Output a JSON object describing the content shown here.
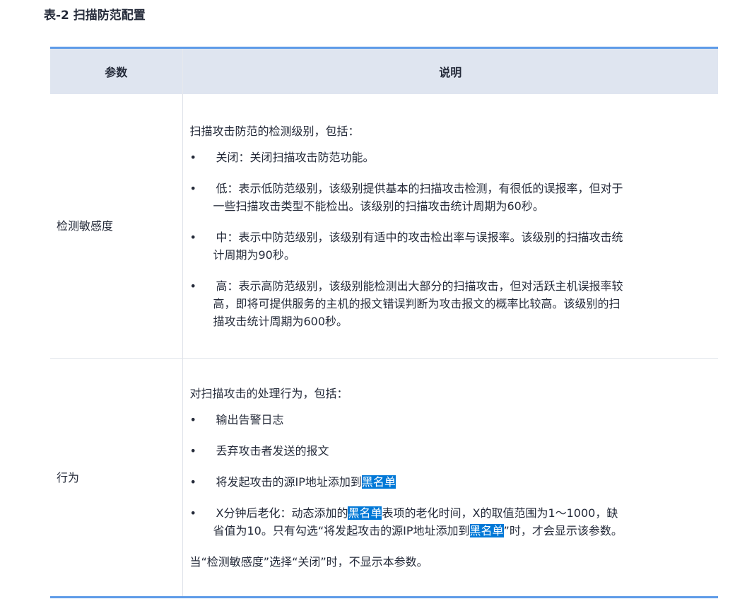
{
  "caption": "表-2 扫描防范配置",
  "table": {
    "headers": {
      "param": "参数",
      "desc": "说明"
    },
    "rows": [
      {
        "param": "检测敏感度",
        "intro": "扫描攻击防范的检测级别，包括：",
        "items": [
          "关闭：关闭扫描攻击防范功能。",
          "低：表示低防范级别，该级别提供基本的扫描攻击检测，有很低的误报率，但对于一些扫描攻击类型不能检出。该级别的扫描攻击统计周期为60秒。",
          "中：表示中防范级别，该级别有适中的攻击检出率与误报率。该级别的扫描攻击统计周期为90秒。",
          "高：表示高防范级别，该级别能检测出大部分的扫描攻击，但对活跃主机误报率较高，即将可提供服务的主机的报文错误判断为攻击报文的概率比较高。该级别的扫描攻击统计周期为600秒。"
        ]
      },
      {
        "param": "行为",
        "intro": "对扫描攻击的处理行为，包括：",
        "items": [
          "输出告警日志",
          "丢弃攻击者发送的报文"
        ],
        "item3_text": "将发起攻击的源IP地址添加到",
        "blacklist": "黑名单",
        "item4_a": "X分钟后老化：动态添加的",
        "item4_b": "表项的老化时间，X的取值范围为1～1000，缺省值为10。只有勾选“将发起攻击的源IP地址添加到",
        "item4_c": "”时，才会显示该参数。",
        "note": "当“检测敏感度”选择“关闭”时，不显示本参数。"
      }
    ]
  },
  "bullet_char": "•",
  "colors": {
    "accent": "#5e9be8",
    "header_bg": "#dfe5f0",
    "highlight": "#0078d7"
  }
}
